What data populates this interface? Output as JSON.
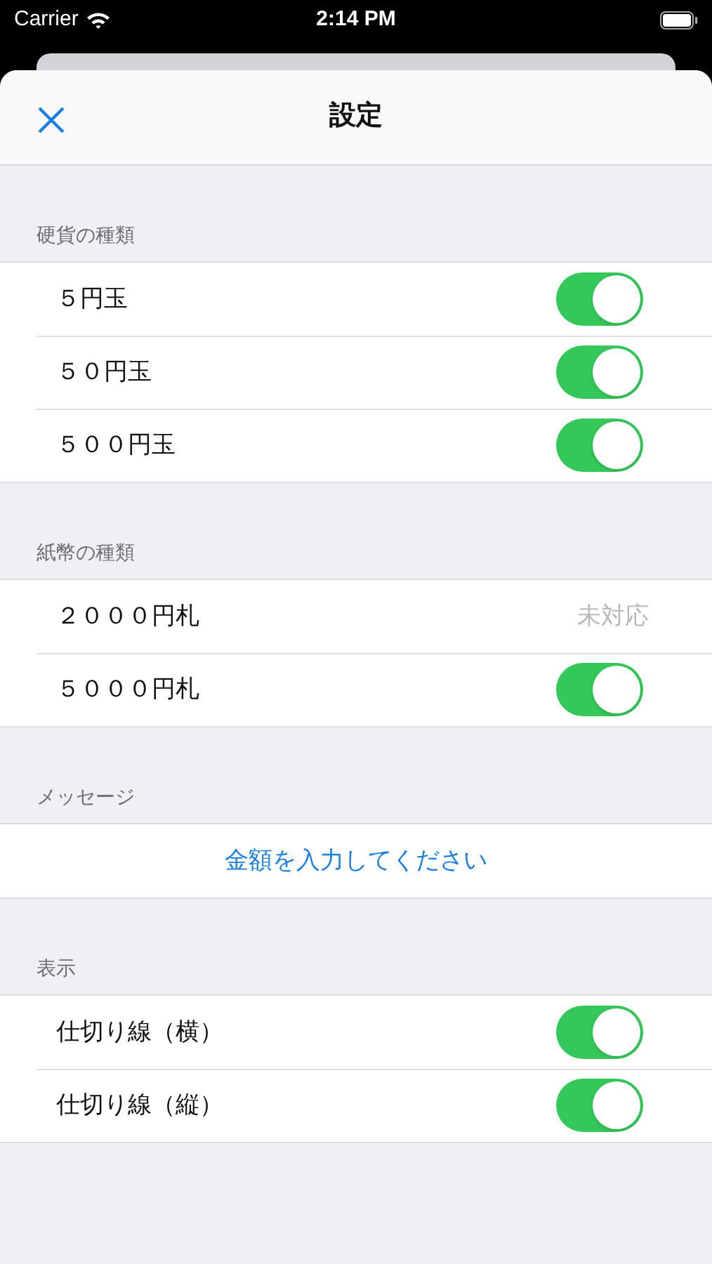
{
  "status_bar": {
    "carrier": "Carrier",
    "time": "2:14 PM"
  },
  "nav": {
    "title": "設定"
  },
  "sections": [
    {
      "header": "硬貨の種類",
      "rows": [
        {
          "kind": "toggle",
          "label": "５円玉",
          "on": true
        },
        {
          "kind": "toggle",
          "label": "５０円玉",
          "on": true
        },
        {
          "kind": "toggle",
          "label": "５００円玉",
          "on": true
        }
      ]
    },
    {
      "header": "紙幣の種類",
      "rows": [
        {
          "kind": "value",
          "label": "２０００円札",
          "value": "未対応"
        },
        {
          "kind": "toggle",
          "label": "５０００円札",
          "on": true
        }
      ]
    },
    {
      "header": "メッセージ",
      "rows": [
        {
          "kind": "action",
          "label": "金額を入力してください"
        }
      ]
    },
    {
      "header": "表示",
      "rows": [
        {
          "kind": "toggle",
          "label": "仕切り線（横）",
          "on": true
        },
        {
          "kind": "toggle",
          "label": "仕切り線（縦）",
          "on": true
        }
      ]
    }
  ]
}
